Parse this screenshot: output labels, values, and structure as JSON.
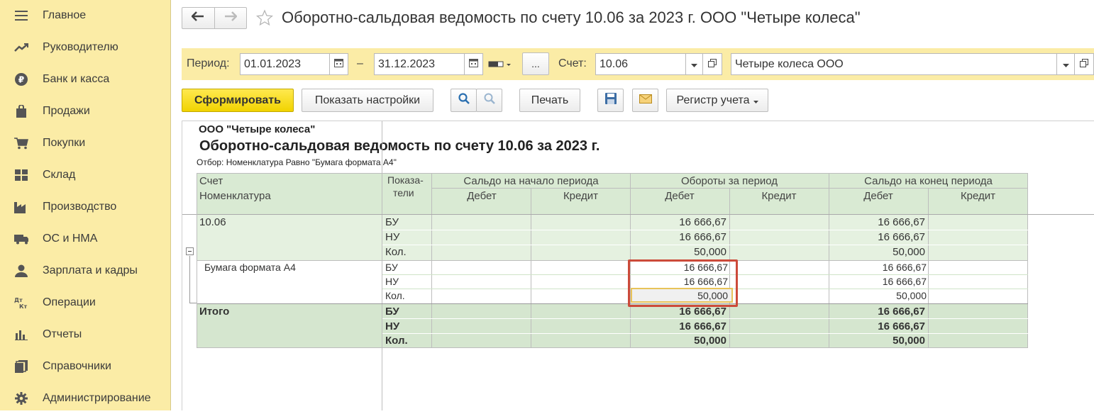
{
  "sidebar": {
    "items": [
      {
        "label": "Главное",
        "icon": "menu-icon"
      },
      {
        "label": "Руководителю",
        "icon": "trend-icon"
      },
      {
        "label": "Банк и касса",
        "icon": "ruble-icon"
      },
      {
        "label": "Продажи",
        "icon": "bag-icon"
      },
      {
        "label": "Покупки",
        "icon": "cart-icon"
      },
      {
        "label": "Склад",
        "icon": "grid-icon"
      },
      {
        "label": "Производство",
        "icon": "factory-icon"
      },
      {
        "label": "ОС и НМА",
        "icon": "truck-icon"
      },
      {
        "label": "Зарплата и кадры",
        "icon": "person-icon"
      },
      {
        "label": "Операции",
        "icon": "dt-kt-icon"
      },
      {
        "label": "Отчеты",
        "icon": "bar-chart-icon"
      },
      {
        "label": "Справочники",
        "icon": "books-icon"
      },
      {
        "label": "Администрирование",
        "icon": "gear-icon"
      }
    ]
  },
  "header": {
    "title": "Оборотно-сальдовая ведомость по счету 10.06 за 2023 г. ООО \"Четыре колеса\""
  },
  "params": {
    "period_label": "Период:",
    "date_from": "01.01.2023",
    "dash": "–",
    "date_to": "31.12.2023",
    "ellipsis": "...",
    "account_label": "Счет:",
    "account": "10.06",
    "organization": "Четыре колеса ООО"
  },
  "toolbar": {
    "generate": "Сформировать",
    "show_settings": "Показать настройки",
    "print": "Печать",
    "register": "Регистр учета"
  },
  "report": {
    "org": "ООО \"Четыре колеса\"",
    "title": "Оборотно-сальдовая ведомость по счету 10.06 за 2023 г.",
    "filter": "Отбор: Номенклатура Равно \"Бумага формата А4\"",
    "headers": {
      "account": "Счет",
      "nomenclature": "Номенклатура",
      "indicators_1": "Показа-",
      "indicators_2": "тели",
      "opening": "Сальдо на начало периода",
      "turnover": "Обороты за период",
      "closing": "Сальдо на конец периода",
      "debit": "Дебет",
      "credit": "Кредит"
    },
    "account_row": {
      "name": "10.06",
      "rows": [
        {
          "ind": "БУ",
          "turn_debit": "16 666,67",
          "close_debit": "16 666,67"
        },
        {
          "ind": "НУ",
          "turn_debit": "16 666,67",
          "close_debit": "16 666,67"
        },
        {
          "ind": "Кол.",
          "turn_debit": "50,000",
          "close_debit": "50,000"
        }
      ]
    },
    "item_row": {
      "name": "Бумага формата А4",
      "rows": [
        {
          "ind": "БУ",
          "turn_debit": "16 666,67",
          "close_debit": "16 666,67"
        },
        {
          "ind": "НУ",
          "turn_debit": "16 666,67",
          "close_debit": "16 666,67"
        },
        {
          "ind": "Кол.",
          "turn_debit": "50,000",
          "close_debit": "50,000"
        }
      ]
    },
    "total_row": {
      "name": "Итого",
      "rows": [
        {
          "ind": "БУ",
          "turn_debit": "16 666,67",
          "close_debit": "16 666,67"
        },
        {
          "ind": "НУ",
          "turn_debit": "16 666,67",
          "close_debit": "16 666,67"
        },
        {
          "ind": "Кол.",
          "turn_debit": "50,000",
          "close_debit": "50,000"
        }
      ]
    }
  },
  "colors": {
    "sidebar_bg": "#fbeca6",
    "header_green": "#d9ead3",
    "primary_button": "#f1d300",
    "highlight_red": "#cc4a3a"
  }
}
